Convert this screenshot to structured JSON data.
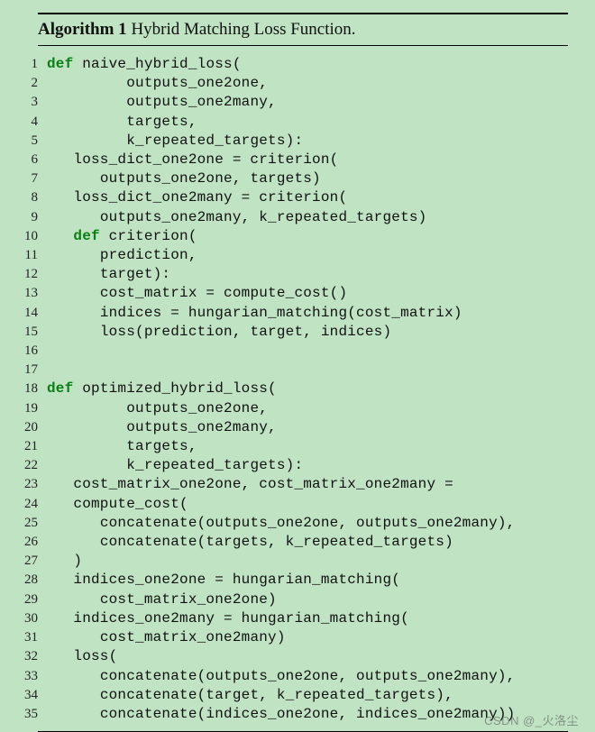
{
  "algorithm": {
    "label": "Algorithm 1",
    "title": "Hybrid Matching Loss Function."
  },
  "code": {
    "lines": [
      {
        "n": "1",
        "ind": 0,
        "tok": [
          {
            "t": "def ",
            "c": "kw"
          },
          {
            "t": "naive_hybrid_loss(",
            "c": "fn"
          }
        ]
      },
      {
        "n": "2",
        "ind": 3,
        "tok": [
          {
            "t": "outputs_one2one,",
            "c": "id"
          }
        ]
      },
      {
        "n": "3",
        "ind": 3,
        "tok": [
          {
            "t": "outputs_one2many,",
            "c": "id"
          }
        ]
      },
      {
        "n": "4",
        "ind": 3,
        "tok": [
          {
            "t": "targets,",
            "c": "id"
          }
        ]
      },
      {
        "n": "5",
        "ind": 3,
        "tok": [
          {
            "t": "k_repeated_targets):",
            "c": "id"
          }
        ]
      },
      {
        "n": "6",
        "ind": 1,
        "tok": [
          {
            "t": "loss_dict_one2one = criterion(",
            "c": "id"
          }
        ]
      },
      {
        "n": "7",
        "ind": 2,
        "tok": [
          {
            "t": "outputs_one2one, targets)",
            "c": "id"
          }
        ]
      },
      {
        "n": "8",
        "ind": 1,
        "tok": [
          {
            "t": "loss_dict_one2many = criterion(",
            "c": "id"
          }
        ]
      },
      {
        "n": "9",
        "ind": 2,
        "tok": [
          {
            "t": "outputs_one2many, k_repeated_targets)",
            "c": "id"
          }
        ]
      },
      {
        "n": "10",
        "ind": 1,
        "tok": [
          {
            "t": "def ",
            "c": "kw"
          },
          {
            "t": "criterion(",
            "c": "fn"
          }
        ]
      },
      {
        "n": "11",
        "ind": 2,
        "tok": [
          {
            "t": "prediction,",
            "c": "id"
          }
        ]
      },
      {
        "n": "12",
        "ind": 2,
        "tok": [
          {
            "t": "target):",
            "c": "id"
          }
        ]
      },
      {
        "n": "13",
        "ind": 2,
        "tok": [
          {
            "t": "cost_matrix = compute_cost()",
            "c": "id"
          }
        ]
      },
      {
        "n": "14",
        "ind": 2,
        "tok": [
          {
            "t": "indices = hungarian_matching(cost_matrix)",
            "c": "id"
          }
        ]
      },
      {
        "n": "15",
        "ind": 2,
        "tok": [
          {
            "t": "loss(prediction, target, indices)",
            "c": "id"
          }
        ]
      },
      {
        "n": "16",
        "ind": 0,
        "tok": []
      },
      {
        "n": "17",
        "ind": 0,
        "tok": []
      },
      {
        "n": "18",
        "ind": 0,
        "tok": [
          {
            "t": "def ",
            "c": "kw"
          },
          {
            "t": "optimized_hybrid_loss(",
            "c": "fn"
          }
        ]
      },
      {
        "n": "19",
        "ind": 3,
        "tok": [
          {
            "t": "outputs_one2one,",
            "c": "id"
          }
        ]
      },
      {
        "n": "20",
        "ind": 3,
        "tok": [
          {
            "t": "outputs_one2many,",
            "c": "id"
          }
        ]
      },
      {
        "n": "21",
        "ind": 3,
        "tok": [
          {
            "t": "targets,",
            "c": "id"
          }
        ]
      },
      {
        "n": "22",
        "ind": 3,
        "tok": [
          {
            "t": "k_repeated_targets):",
            "c": "id"
          }
        ]
      },
      {
        "n": "23",
        "ind": 1,
        "tok": [
          {
            "t": "cost_matrix_one2one, cost_matrix_one2many =",
            "c": "id"
          }
        ]
      },
      {
        "n": "24",
        "ind": 1,
        "tok": [
          {
            "t": "compute_cost(",
            "c": "id"
          }
        ]
      },
      {
        "n": "25",
        "ind": 2,
        "tok": [
          {
            "t": "concatenate(outputs_one2one, outputs_one2many),",
            "c": "id"
          }
        ]
      },
      {
        "n": "26",
        "ind": 2,
        "tok": [
          {
            "t": "concatenate(targets, k_repeated_targets)",
            "c": "id"
          }
        ]
      },
      {
        "n": "27",
        "ind": 1,
        "tok": [
          {
            "t": ")",
            "c": "id"
          }
        ]
      },
      {
        "n": "28",
        "ind": 1,
        "tok": [
          {
            "t": "indices_one2one = hungarian_matching(",
            "c": "id"
          }
        ]
      },
      {
        "n": "29",
        "ind": 2,
        "tok": [
          {
            "t": "cost_matrix_one2one)",
            "c": "id"
          }
        ]
      },
      {
        "n": "30",
        "ind": 1,
        "tok": [
          {
            "t": "indices_one2many = hungarian_matching(",
            "c": "id"
          }
        ]
      },
      {
        "n": "31",
        "ind": 2,
        "tok": [
          {
            "t": "cost_matrix_one2many)",
            "c": "id"
          }
        ]
      },
      {
        "n": "32",
        "ind": 1,
        "tok": [
          {
            "t": "loss(",
            "c": "id"
          }
        ]
      },
      {
        "n": "33",
        "ind": 2,
        "tok": [
          {
            "t": "concatenate(outputs_one2one, outputs_one2many),",
            "c": "id"
          }
        ]
      },
      {
        "n": "34",
        "ind": 2,
        "tok": [
          {
            "t": "concatenate(target, k_repeated_targets),",
            "c": "id"
          }
        ]
      },
      {
        "n": "35",
        "ind": 2,
        "tok": [
          {
            "t": "concatenate(indices_one2one, indices_one2many))",
            "c": "id"
          }
        ]
      }
    ],
    "indent_unit_spaces": 3
  },
  "watermark": "CSDN @_火洛尘"
}
